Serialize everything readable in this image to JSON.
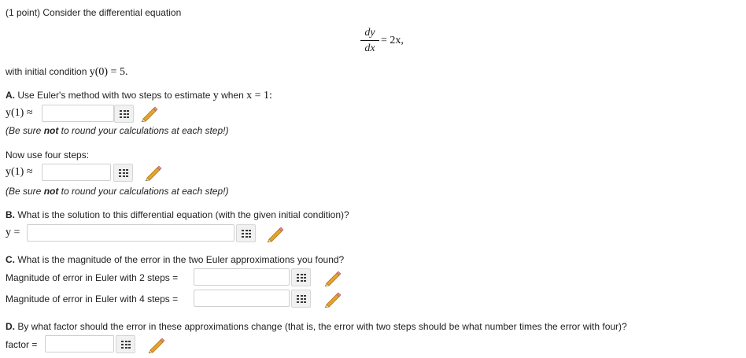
{
  "header": {
    "intro": "(1 point) Consider the differential equation"
  },
  "equation": {
    "numerator": "dy",
    "denominator": "dx",
    "rhs": "= 2x,"
  },
  "initial_condition": {
    "text": "with initial condition ",
    "math": "y(0) = 5."
  },
  "partA": {
    "question_prefix": "A.",
    "question_text": " Use Euler's method with two steps to estimate ",
    "question_math": "y",
    "question_text2": " when ",
    "question_math2": "x = 1:",
    "label_two_steps": "y(1) ≈",
    "hint_pre": "(Be sure ",
    "hint_bold": "not",
    "hint_post": " to round your calculations at each step!)",
    "four_steps_text": "Now use four steps:",
    "label_four_steps": "y(1) ≈",
    "hint2_pre": "(Be sure ",
    "hint2_bold": "not",
    "hint2_post": " to round your calculations at each step!)"
  },
  "partB": {
    "question_prefix": "B.",
    "question_text": " What is the solution to this differential equation (with the given initial condition)?",
    "label": "y ="
  },
  "partC": {
    "question_prefix": "C.",
    "question_text": " What is the magnitude of the error in the two Euler approximations you found?",
    "label_two": "Magnitude of error in Euler with 2 steps =",
    "label_four": "Magnitude of error in Euler with 4 steps ="
  },
  "partD": {
    "question_prefix": "D.",
    "question_text": " By what factor should the error in these approximations change (that is, the error with two steps should be what number times the error with four)?",
    "label": "factor ="
  },
  "icons": {
    "palette": "equation-editor-grid-icon",
    "pencil": "pencil-edit-icon"
  },
  "colors": {
    "pencil_body": "#e8a32a",
    "pencil_tip": "#3a6fc4"
  }
}
